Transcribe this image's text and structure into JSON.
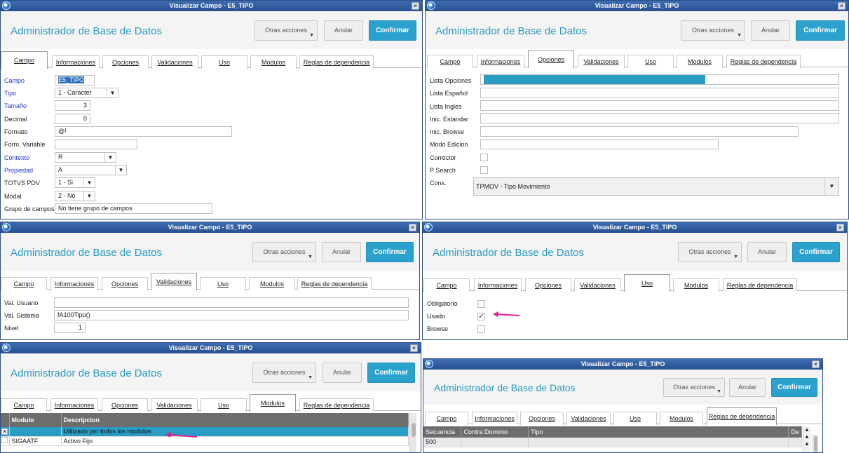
{
  "window_title": "Visualizar Campo - E5_TIPO",
  "app_title": "Administrador de Base de Datos",
  "buttons": {
    "other_actions": "Otras acciones",
    "cancel": "Anular",
    "confirm": "Confirmar"
  },
  "tabs": [
    "Campo",
    "Informaciones",
    "Opciones",
    "Validaciones",
    "Uso",
    "Modulos",
    "Reglas de dependencia"
  ],
  "campo": {
    "labels": {
      "campo": "Campo",
      "tipo": "Tipo",
      "tamano": "Tamaño",
      "decimal": "Decimal",
      "formato": "Formato",
      "form_variable": "Form. Variable",
      "contexto": "Contexto",
      "propiedad": "Propiedad",
      "totvs_pdv": "TOTVS PDV",
      "modal": "Modal",
      "grupo_campos": "Grupo de campos"
    },
    "values": {
      "campo": "E5_TIPO",
      "tipo": "1 - Caracter",
      "tamano": "3",
      "decimal": "0",
      "formato": "@!",
      "form_variable": "",
      "contexto": "R",
      "propiedad": "A",
      "totvs_pdv": "1 - Si",
      "modal": "2 - No",
      "grupo_campos": "No tiene grupo de campos"
    }
  },
  "opciones": {
    "labels": {
      "lista_opciones": "Lista Opciones",
      "lista_espanol": "Lista Español",
      "lista_ingles": "Lista Ingles",
      "inic_estandar": "Inic. Estandar",
      "inic_browse": "Inic. Browse",
      "modo_edicion": "Modo Edicion",
      "corrector": "Corrector",
      "p_search": "P Search",
      "cons": "Cons."
    },
    "cons_value": "TPMOV - Tipo Movimiento",
    "lista_opciones_fill": 0.63
  },
  "validaciones": {
    "labels": {
      "val_usuario": "Val. Usuario",
      "val_sistema": "Val. Sistema",
      "nivel": "Nivel"
    },
    "values": {
      "val_usuario": "",
      "val_sistema": "fA100Tipo()",
      "nivel": "1"
    }
  },
  "uso": {
    "labels": {
      "obligatorio": "Obligatorio",
      "usado": "Usado",
      "browse": "Browse"
    },
    "checked": {
      "obligatorio": false,
      "usado": true,
      "browse": false
    }
  },
  "modulos": {
    "columns": [
      "Modulo",
      "Descripcion"
    ],
    "rows": [
      {
        "modulo": "",
        "descripcion": "Utilizado por todos los modulos",
        "checked": true,
        "selected": true
      },
      {
        "modulo": "SIGAATF",
        "descripcion": "Activo Fijo",
        "checked": false,
        "selected": false
      }
    ]
  },
  "reglas": {
    "columns": [
      "Secuencia",
      "Contra Dominio",
      "Tipo",
      "De"
    ],
    "rows": [
      {
        "secuencia": "500",
        "contra_dominio": "",
        "tipo": ""
      }
    ]
  },
  "annotation_color": "#e0208a"
}
